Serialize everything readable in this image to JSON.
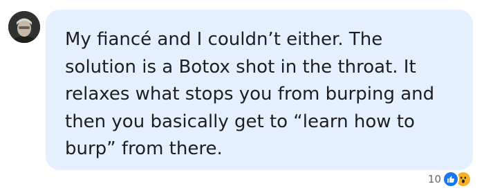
{
  "comment": {
    "author_avatar": "avatar",
    "text": "My fiancé and I couldn’t either. The solution is a Botox shot in the throat. It relaxes what stops you from burping and then you basically get to “learn how to burp” from there.",
    "bubble_color": "#e4f0fd",
    "text_color": "#1c1e21"
  },
  "reactions": {
    "count": "10",
    "icons": [
      "like-icon",
      "wow-icon"
    ],
    "like_color": "#1877f2",
    "wow_color": "#f7b125"
  }
}
